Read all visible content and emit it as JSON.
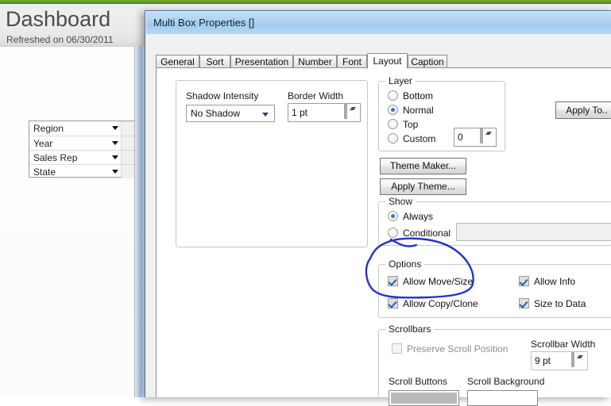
{
  "background_app": {
    "title": "Dashboard",
    "subtitle": "Refreshed on  06/30/2011",
    "listbox_rows": [
      {
        "label": "Region"
      },
      {
        "label": "Year"
      },
      {
        "label": "Sales Rep"
      },
      {
        "label": "State"
      }
    ]
  },
  "dialog": {
    "title": "Multi Box Properties []",
    "tabs": [
      {
        "label": "General",
        "active": false
      },
      {
        "label": "Sort",
        "active": false
      },
      {
        "label": "Presentation",
        "active": false
      },
      {
        "label": "Number",
        "active": false
      },
      {
        "label": "Font",
        "active": false
      },
      {
        "label": "Layout",
        "active": true
      },
      {
        "label": "Caption",
        "active": false
      }
    ],
    "apply_to_button": "Apply To..",
    "left_panel": {
      "shadow_intensity_label": "Shadow Intensity",
      "shadow_intensity_value": "No Shadow",
      "border_width_label": "Border Width",
      "border_width_value": "1 pt"
    },
    "layer_group": {
      "title": "Layer",
      "options": [
        {
          "label": "Bottom",
          "checked": false
        },
        {
          "label": "Normal",
          "checked": true
        },
        {
          "label": "Top",
          "checked": false
        },
        {
          "label": "Custom",
          "checked": false
        }
      ],
      "custom_value": "0"
    },
    "theme_buttons": {
      "theme_maker": "Theme Maker...",
      "apply_theme": "Apply Theme..."
    },
    "show_group": {
      "title": "Show",
      "options": [
        {
          "label": "Always",
          "checked": true
        },
        {
          "label": "Conditional",
          "checked": false
        }
      ],
      "conditional_value": ""
    },
    "options_group": {
      "title": "Options",
      "items": [
        {
          "label": "Allow Move/Size",
          "checked": true
        },
        {
          "label": "Allow Info",
          "checked": true
        },
        {
          "label": "Allow Copy/Clone",
          "checked": true
        },
        {
          "label": "Size to Data",
          "checked": true
        }
      ]
    },
    "scrollbars_group": {
      "title": "Scrollbars",
      "preserve_scroll_position": {
        "label": "Preserve Scroll Position",
        "checked": false,
        "disabled": true
      },
      "scrollbar_width_label": "Scrollbar Width",
      "scrollbar_width_value": "9 pt",
      "scroll_buttons_label": "Scroll Buttons",
      "scroll_background_label": "Scroll Background",
      "scroll_buttons_color": "#b9b9b9",
      "scroll_background_color": "#ffffff"
    }
  },
  "annotation": {
    "shape": "hand-drawn-circle",
    "color": "#2233cc",
    "encircles": "Allow Move/Size"
  }
}
